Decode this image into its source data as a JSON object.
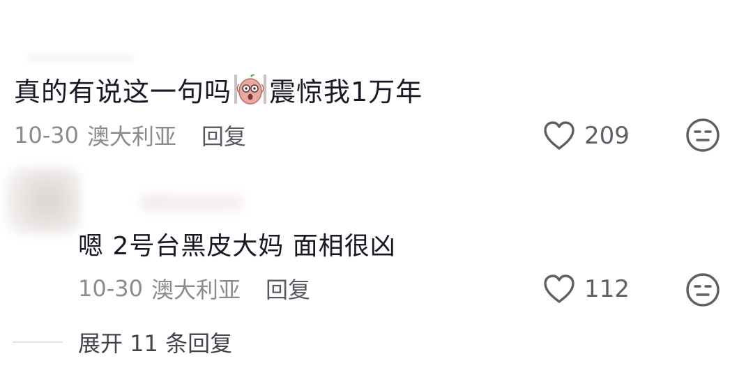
{
  "comments": [
    {
      "text_before": "真的有说这一句吗",
      "sticker_icon": "shocked-sticker-icon",
      "text_after": "震惊我1万年",
      "date": "10-30",
      "location": "澳大利亚",
      "reply_label": "回复",
      "likes": "209"
    },
    {
      "text": "嗯 2号台黑皮大妈 面相很凶",
      "date": "10-30",
      "location": "澳大利亚",
      "reply_label": "回复",
      "likes": "112"
    }
  ],
  "expand_replies": "展开 11 条回复",
  "icons": {
    "like": "heart-icon",
    "dislike": "neutral-face-icon"
  },
  "colors": {
    "text": "#161823",
    "meta": "#8a8b91",
    "icon": "#5e5f66"
  }
}
